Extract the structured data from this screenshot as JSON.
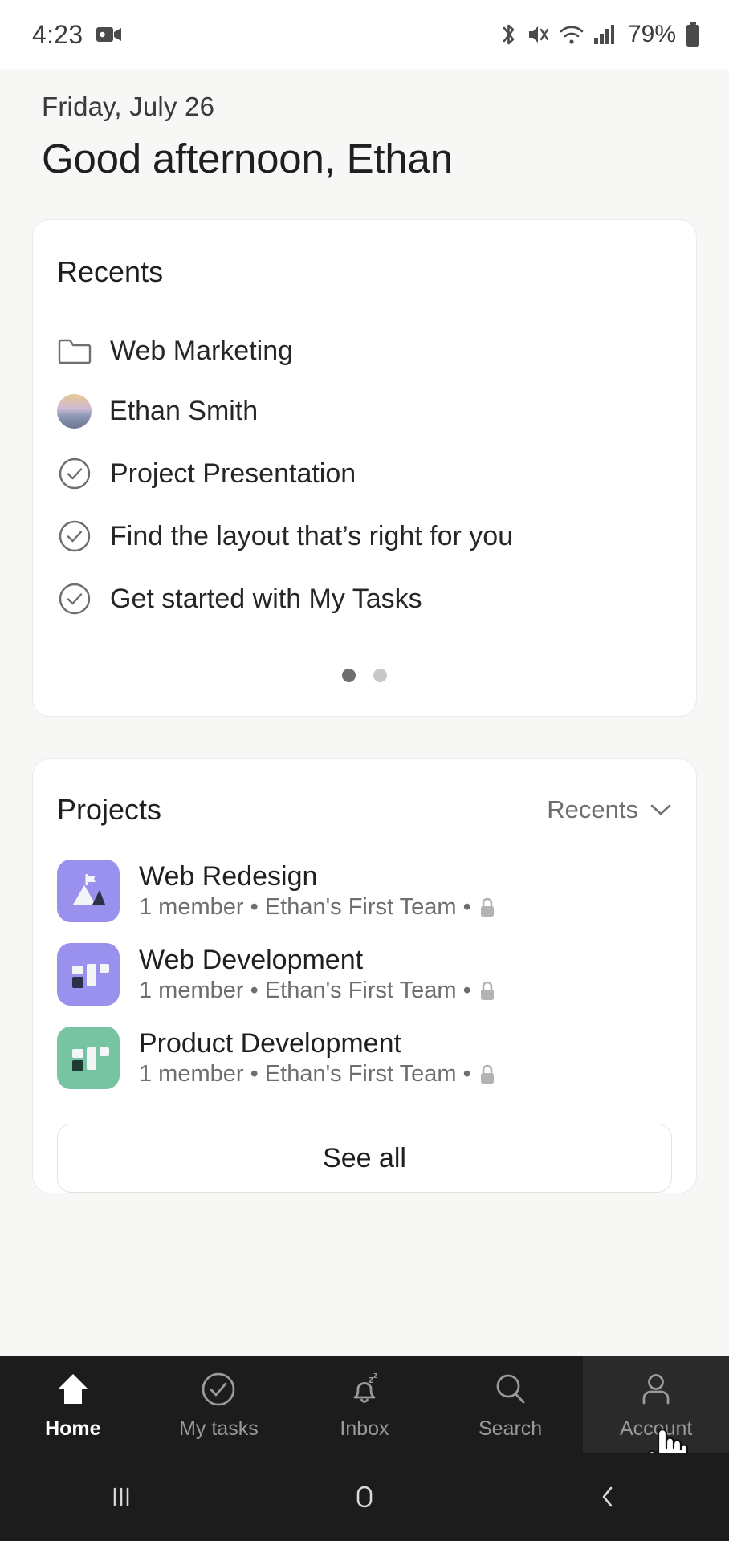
{
  "status_bar": {
    "time": "4:23",
    "battery_percent": "79%",
    "icons": [
      "video-camera-icon",
      "bluetooth-icon",
      "mute-icon",
      "wifi-icon",
      "signal-icon",
      "battery-icon"
    ]
  },
  "greeting": {
    "date": "Friday, July 26",
    "message": "Good afternoon, Ethan"
  },
  "recents_card": {
    "title": "Recents",
    "items": [
      {
        "label": "Web Marketing",
        "icon": "folder-icon"
      },
      {
        "label": "Ethan Smith",
        "icon": "avatar-icon"
      },
      {
        "label": "Project Presentation",
        "icon": "check-circle-icon"
      },
      {
        "label": "Find the layout that’s right for you",
        "icon": "check-circle-icon"
      },
      {
        "label": "Get started with My Tasks",
        "icon": "check-circle-icon"
      }
    ],
    "pagination": {
      "total": 2,
      "active_index": 0
    }
  },
  "projects_card": {
    "title": "Projects",
    "sort_label": "Recents",
    "sort_icon": "chevron-down-icon",
    "items": [
      {
        "name": "Web Redesign",
        "meta": "1 member • Ethan's First Team •",
        "icon": "mountain-icon",
        "icon_color": "#9a91ef",
        "privacy_icon": "lock-icon"
      },
      {
        "name": "Web Development",
        "meta": "1 member • Ethan's First Team •",
        "icon": "board-icon",
        "icon_color": "#9a91ef",
        "privacy_icon": "lock-icon"
      },
      {
        "name": "Product Development",
        "meta": "1 member • Ethan's First Team •",
        "icon": "board-icon",
        "icon_color": "#77c4a3",
        "privacy_icon": "lock-icon"
      }
    ],
    "see_all_label": "See all"
  },
  "bottom_nav": {
    "items": [
      {
        "label": "Home",
        "icon": "home-icon",
        "active": true
      },
      {
        "label": "My tasks",
        "icon": "check-circle-icon",
        "active": false
      },
      {
        "label": "Inbox",
        "icon": "bell-snooze-icon",
        "active": false
      },
      {
        "label": "Search",
        "icon": "search-icon",
        "active": false
      },
      {
        "label": "Account",
        "icon": "person-icon",
        "active": false
      }
    ]
  },
  "system_nav": {
    "items": [
      {
        "name": "recent-apps",
        "icon": "recent-apps-icon"
      },
      {
        "name": "home",
        "icon": "home-square-icon"
      },
      {
        "name": "back",
        "icon": "back-chevron-icon"
      }
    ]
  },
  "colors": {
    "page_bg": "#f7f7f6",
    "card_bg": "#ffffff",
    "nav_bg": "#1c1c1c",
    "purple": "#9a91ef",
    "green": "#77c4a3"
  }
}
